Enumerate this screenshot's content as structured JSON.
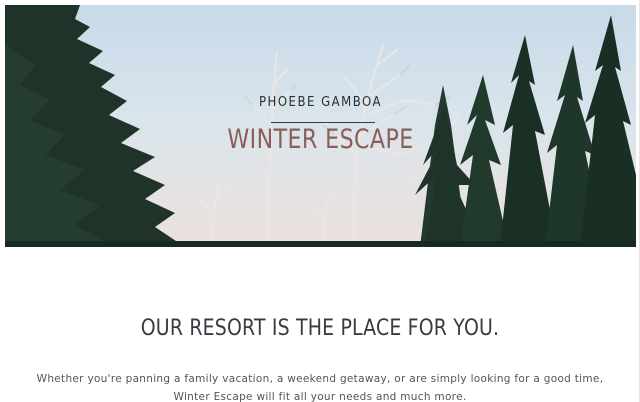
{
  "hero": {
    "author": "PHOEBE GAMBOA",
    "title": "WINTER ESCAPE",
    "title_color": "#8a5e58"
  },
  "content": {
    "headline": "OUR RESORT IS THE PLACE FOR YOU.",
    "body_line_1": "Whether you're panning a family vacation, a weekend getaway, or are simply looking for a good time,",
    "body_line_2": "Winter Escape will fit all your needs and much more."
  }
}
